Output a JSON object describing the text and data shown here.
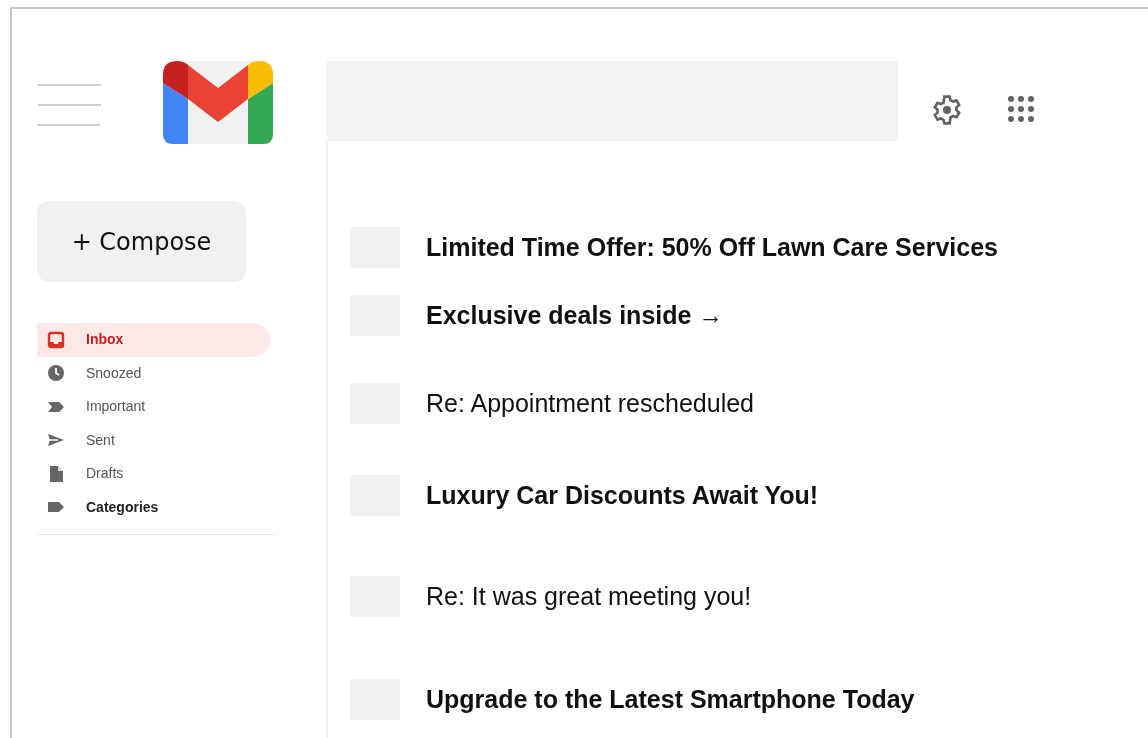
{
  "sidebar": {
    "compose": "+ Compose",
    "items": [
      {
        "label": "Inbox",
        "kind": "folder",
        "selected": true
      },
      {
        "label": "Snoozed",
        "kind": "folder",
        "selected": false
      },
      {
        "label": "Important",
        "kind": "folder",
        "selected": false
      },
      {
        "label": "Sent",
        "kind": "folder",
        "selected": false
      },
      {
        "label": "Drafts",
        "kind": "folder",
        "selected": false
      },
      {
        "label": "Categories",
        "kind": "group",
        "selected": false
      }
    ]
  },
  "emails": [
    {
      "subject": "Limited Time Offer: 50% Off Lawn Care Services",
      "unread": true,
      "checked": false
    },
    {
      "subject": "Exclusive deals inside →",
      "unread": true,
      "checked": false
    },
    {
      "subject": "Re: Appointment rescheduled",
      "unread": false,
      "checked": false
    },
    {
      "subject": "Luxury Car Discounts Await You!",
      "unread": true,
      "checked": false
    },
    {
      "subject": "Re: It was great meeting you!",
      "unread": false,
      "checked": false
    },
    {
      "subject": "Upgrade to the Latest Smartphone Today",
      "unread": true,
      "checked": false
    }
  ]
}
